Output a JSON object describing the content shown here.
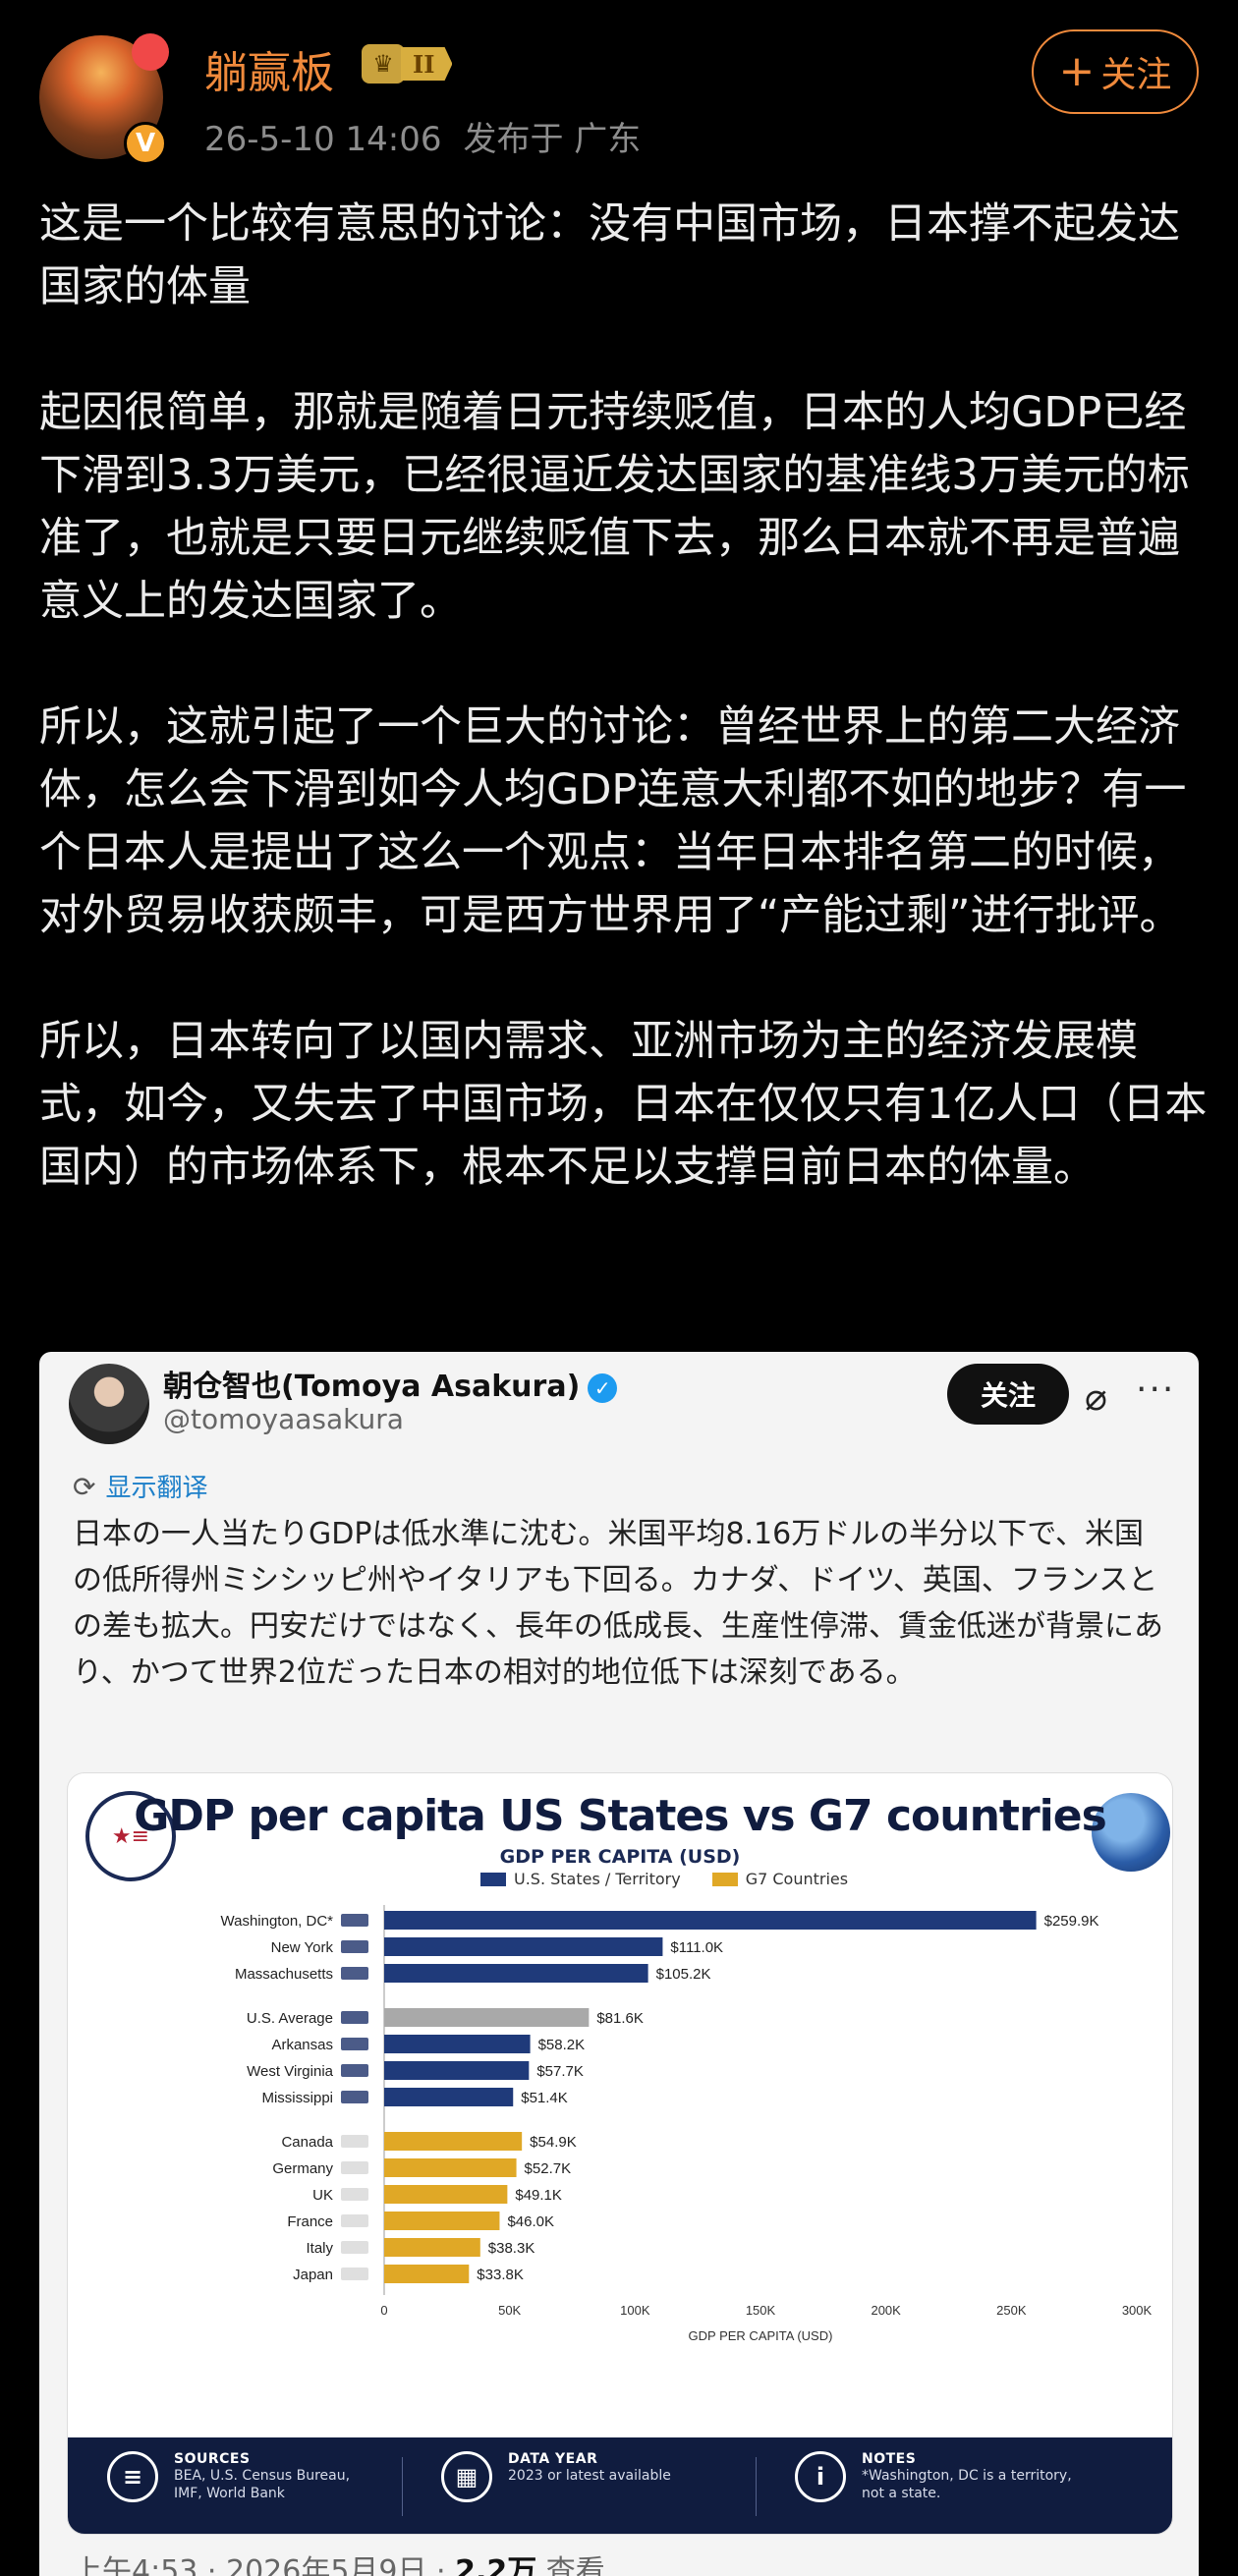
{
  "post": {
    "username": "躺赢板",
    "level": "II",
    "time": "26-5-10 14:06",
    "location": "发布于 广东",
    "follow_label": "关注",
    "paragraphs": [
      "这是一个比较有意思的讨论：没有中国市场，日本撑不起发达国家的体量",
      "起因很简单，那就是随着日元持续贬值，日本的人均GDP已经下滑到3.3万美元，已经很逼近发达国家的基准线3万美元的标准了，也就是只要日元继续贬值下去，那么日本就不再是普遍意义上的发达国家了。",
      "所以，这就引起了一个巨大的讨论：曾经世界上的第二大经济体，怎么会下滑到如今人均GDP连意大利都不如的地步？有一个日本人是提出了这么一个观点：当年日本排名第二的时候，对外贸易收获颇丰，可是西方世界用了“产能过剩”进行批评。",
      "所以，日本转向了以国内需求、亚洲市场为主的经济发展模式，如今，又失去了中国市场，日本在仅仅只有1亿人口（日本国内）的市场体系下，根本不足以支撑目前日本的体量。"
    ]
  },
  "tweet": {
    "name": "朝仓智也(Tomoya Asakura)",
    "handle": "@tomoyaasakura",
    "follow_label": "关注",
    "more": "···",
    "translate_label": "显示翻译",
    "text": "日本の一人当たりGDPは低水準に沈む。米国平均8.16万ドルの半分以下で、米国の低所得州ミシシッピ州やイタリアも下回る。カナダ、ドイツ、英国、フランスとの差も拡大。円安だけではなく、長年の低成長、生産性停滞、賃金低迷が背景にあり、かつて世界2位だった日本の相対的地位低下は深刻である。",
    "footer_time": "上午4:53 · 2026年5月9日 · ",
    "views_count": "2.2万",
    "views_label": " 查看"
  },
  "infographic": {
    "title": "GDP per capita US States vs G7 countries",
    "footer": {
      "sources_head": "SOURCES",
      "sources_l1": "BEA, U.S. Census Bureau,",
      "sources_l2": "IMF, World Bank",
      "year_head": "DATA YEAR",
      "year_l1": "2023 or latest available",
      "notes_head": "NOTES",
      "notes_l1": "*Washington, DC is a territory,",
      "notes_l2": "not a state."
    }
  },
  "chart_data": {
    "type": "bar",
    "orientation": "horizontal",
    "title": "GDP PER CAPITA (USD)",
    "xlabel": "GDP PER CAPITA (USD)",
    "xlim": [
      0,
      300
    ],
    "xticks": [
      "0",
      "50K",
      "100K",
      "150K",
      "200K",
      "250K",
      "300K"
    ],
    "legend": [
      {
        "name": "U.S. States / Territory",
        "color": "#1f3a7a"
      },
      {
        "name": "G7 Countries",
        "color": "#e0a826"
      }
    ],
    "colors": {
      "us": "#1f3a7a",
      "avg": "#a9a9a9",
      "g7": "#e0a826"
    },
    "bars": [
      {
        "label": "Washington, DC*",
        "value": 259.9,
        "value_label": "$259.9K",
        "group": "us"
      },
      {
        "label": "New York",
        "value": 111.0,
        "value_label": "$111.0K",
        "group": "us"
      },
      {
        "label": "Massachusetts",
        "value": 105.2,
        "value_label": "$105.2K",
        "group": "us"
      },
      {
        "label": "U.S. Average",
        "value": 81.6,
        "value_label": "$81.6K",
        "group": "avg"
      },
      {
        "label": "Arkansas",
        "value": 58.2,
        "value_label": "$58.2K",
        "group": "us"
      },
      {
        "label": "West Virginia",
        "value": 57.7,
        "value_label": "$57.7K",
        "group": "us"
      },
      {
        "label": "Mississippi",
        "value": 51.4,
        "value_label": "$51.4K",
        "group": "us"
      },
      {
        "label": "Canada",
        "value": 54.9,
        "value_label": "$54.9K",
        "group": "g7"
      },
      {
        "label": "Germany",
        "value": 52.7,
        "value_label": "$52.7K",
        "group": "g7"
      },
      {
        "label": "UK",
        "value": 49.1,
        "value_label": "$49.1K",
        "group": "g7"
      },
      {
        "label": "France",
        "value": 46.0,
        "value_label": "$46.0K",
        "group": "g7"
      },
      {
        "label": "Italy",
        "value": 38.3,
        "value_label": "$38.3K",
        "group": "g7"
      },
      {
        "label": "Japan",
        "value": 33.8,
        "value_label": "$33.8K",
        "group": "g7"
      }
    ]
  }
}
